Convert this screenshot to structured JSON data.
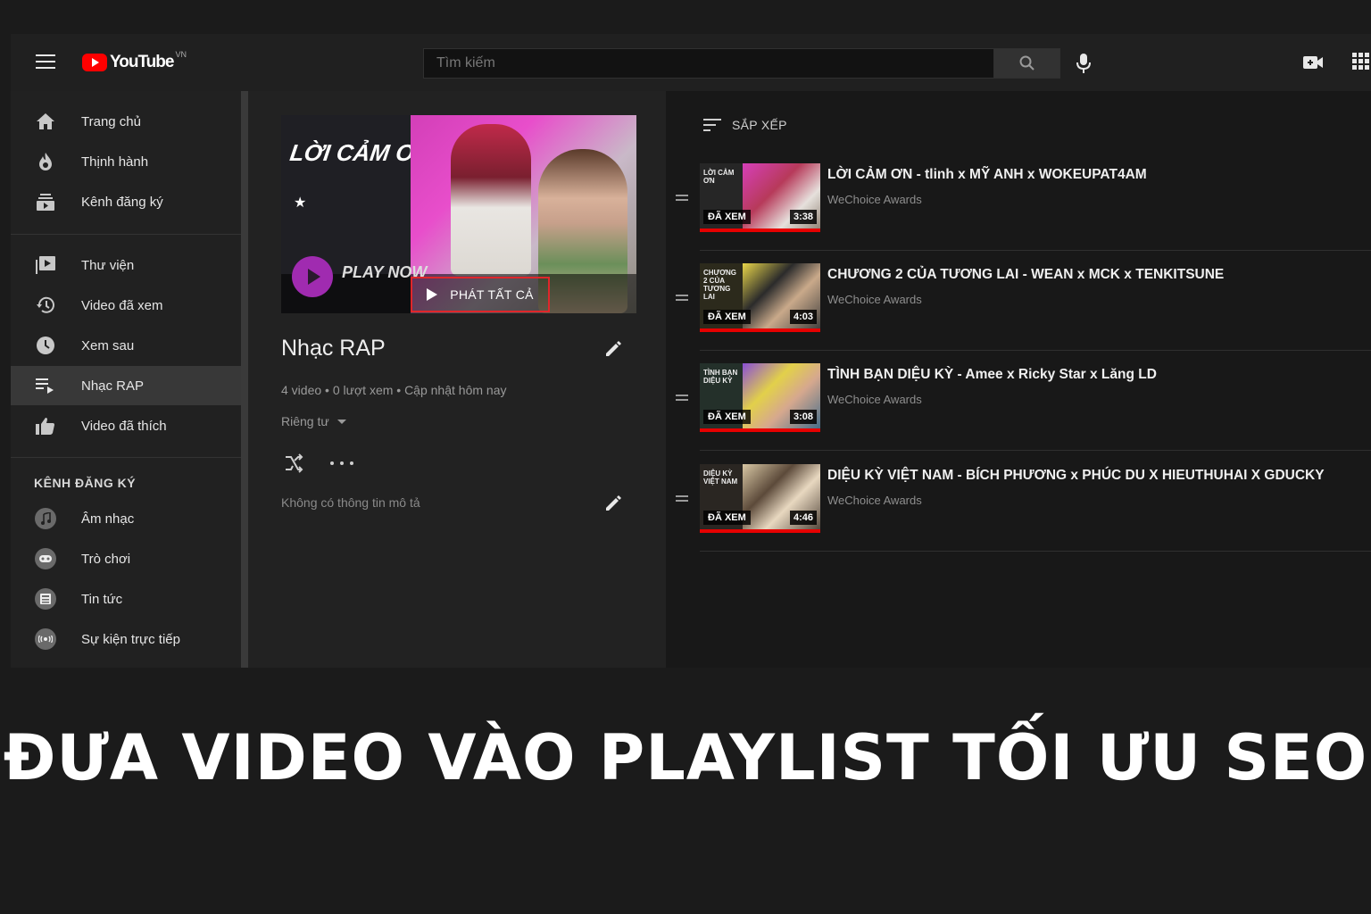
{
  "header": {
    "logo_text": "YouTube",
    "region": "VN",
    "search_placeholder": "Tìm kiếm"
  },
  "sidebar": {
    "items": [
      {
        "label": "Trang chủ",
        "icon": "home-icon"
      },
      {
        "label": "Thịnh hành",
        "icon": "trending-icon"
      },
      {
        "label": "Kênh đăng ký",
        "icon": "subscriptions-icon"
      },
      {
        "label": "Thư viện",
        "icon": "library-icon"
      },
      {
        "label": "Video đã xem",
        "icon": "history-icon"
      },
      {
        "label": "Xem sau",
        "icon": "watch-later-icon"
      },
      {
        "label": "Nhạc RAP",
        "icon": "playlist-icon",
        "active": true
      },
      {
        "label": "Video đã thích",
        "icon": "like-icon"
      }
    ],
    "subs_header": "KÊNH ĐĂNG KÝ",
    "subs": [
      {
        "label": "Âm nhạc",
        "icon": "music-icon"
      },
      {
        "label": "Trò chơi",
        "icon": "gaming-icon"
      },
      {
        "label": "Tin tức",
        "icon": "news-icon"
      },
      {
        "label": "Sự kiện trực tiếp",
        "icon": "live-icon"
      }
    ]
  },
  "playlist": {
    "thumb_title": "LỜI CẢM ƠN",
    "thumb_play_now": "PLAY NOW",
    "play_all_label": "PHÁT TẤT CẢ",
    "title": "Nhạc RAP",
    "stats": "4 video • 0 lượt xem • Cập nhật hôm nay",
    "privacy": "Riêng tư",
    "description": "Không có thông tin mô tả"
  },
  "list": {
    "sort_label": "SẮP XẾP",
    "watched_badge": "ĐÃ XEM",
    "videos": [
      {
        "title": "LỜI CẢM ƠN - tlinh x MỸ ANH x WOKEUPAT4AM",
        "channel": "WeChoice Awards",
        "duration": "3:38",
        "thumb_text": "LỜI CẢM ƠN",
        "progress": 1.0
      },
      {
        "title": "CHƯƠNG 2 CỦA TƯƠNG LAI - WEAN x MCK x TENKITSUNE",
        "channel": "WeChoice Awards",
        "duration": "4:03",
        "thumb_text": "CHƯƠNG 2 CỦA TƯƠNG LAI",
        "progress": 1.0
      },
      {
        "title": "TÌNH BẠN DIỆU KỲ - Amee x Ricky Star x Lăng LD",
        "channel": "WeChoice Awards",
        "duration": "3:08",
        "thumb_text": "TÌNH BẠN DIỆU KỲ",
        "progress": 1.0
      },
      {
        "title": "DIỆU KỲ VIỆT NAM - BÍCH PHƯƠNG x PHÚC DU X HIEUTHUHAI X GDUCKY",
        "channel": "WeChoice Awards",
        "duration": "4:46",
        "thumb_text": "DIỆU KỲ VIỆT NAM",
        "progress": 1.0
      }
    ]
  },
  "caption": "ĐƯA VIDEO VÀO PLAYLIST TỐI ƯU SEO",
  "colors": {
    "brand_red": "#ff0000",
    "highlight_red": "#e0262a",
    "progress_red": "#e60000"
  }
}
